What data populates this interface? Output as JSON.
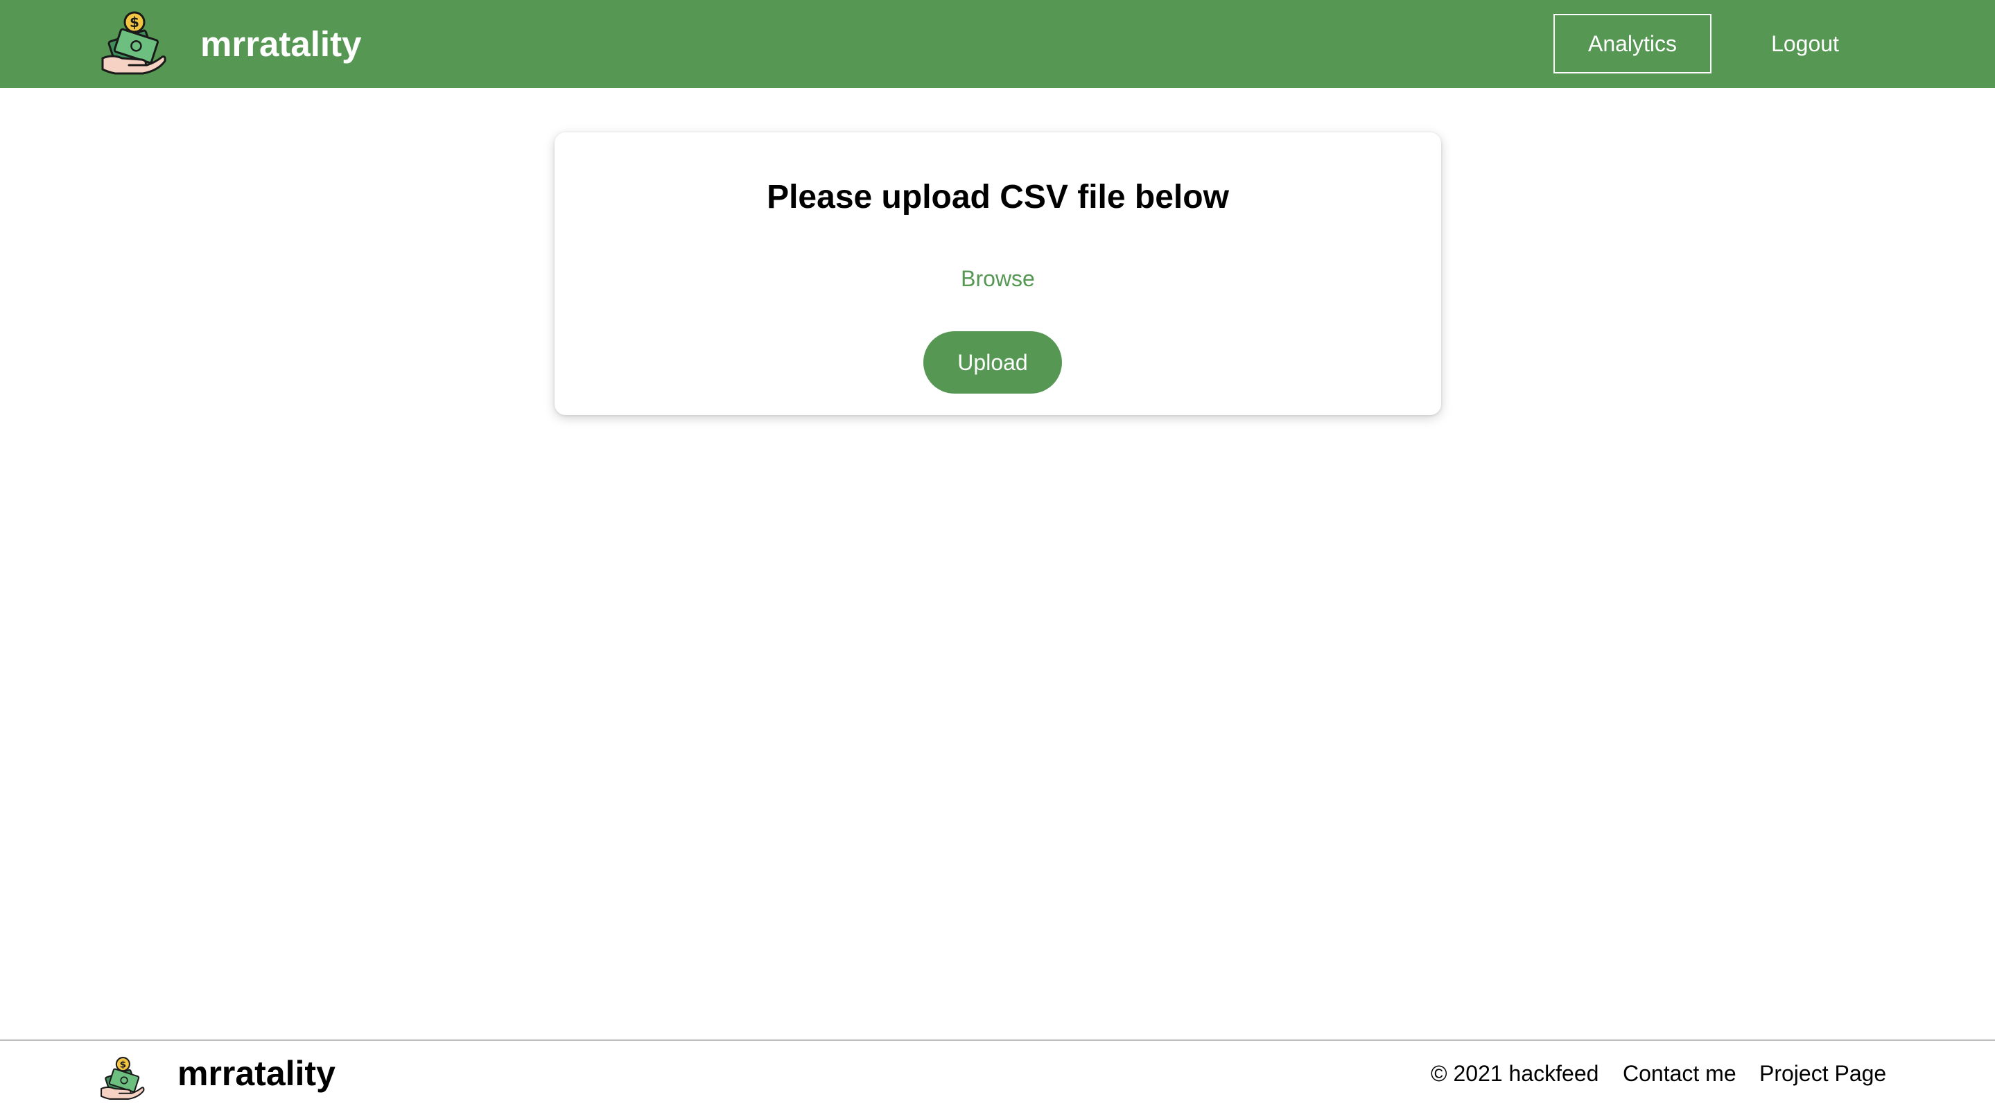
{
  "header": {
    "brand": "mrratality",
    "logo_icon": "money-hand-icon",
    "nav": {
      "analytics_label": "Analytics",
      "logout_label": "Logout"
    },
    "background_color": "#559753"
  },
  "upload_card": {
    "title": "Please upload CSV file below",
    "browse_label": "Browse",
    "upload_label": "Upload",
    "accent_color": "#559753"
  },
  "footer": {
    "brand": "mrratality",
    "logo_icon": "money-hand-icon",
    "copyright": "© 2021 hackfeed",
    "contact_label": "Contact me",
    "project_label": "Project Page"
  }
}
